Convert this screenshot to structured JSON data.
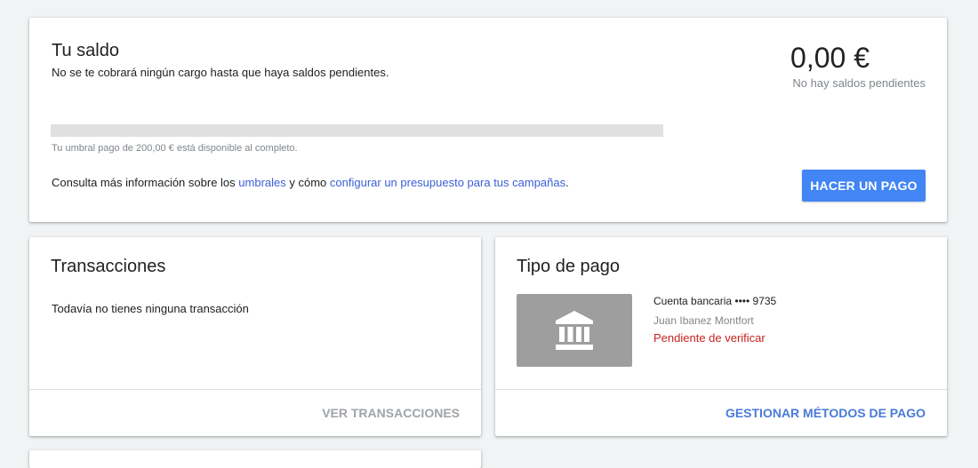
{
  "balance": {
    "title": "Tu saldo",
    "subtitle": "No se te cobrará ningún cargo hasta que haya saldos pendientes.",
    "amount": "0,00 €",
    "amount_caption": "No hay saldos pendientes",
    "threshold_progress": 0,
    "threshold_caption": "Tu umbral pago de 200,00 € está disponible al completo.",
    "info_prefix": "Consulta más información sobre los",
    "info_link1": "umbrales",
    "info_middle": "y cómo",
    "info_link2": "configurar un presupuesto para tus campañas",
    "info_suffix": ".",
    "pay_button": "HACER UN PAGO"
  },
  "transactions": {
    "title": "Transacciones",
    "empty_text": "Todavía no tienes ninguna transacción",
    "footer_link": "VER TRANSACCIONES"
  },
  "payment": {
    "title": "Tipo de pago",
    "icon": "bank-icon",
    "account_label": "Cuenta bancaria •••• 9735",
    "holder": "Juan Ibanez Montfort",
    "status": "Pendiente de verificar",
    "footer_link": "GESTIONAR MÉTODOS DE PAGO"
  },
  "colors": {
    "accent": "#4285f4",
    "link": "#3c5fd6",
    "warning": "#c5221f"
  }
}
